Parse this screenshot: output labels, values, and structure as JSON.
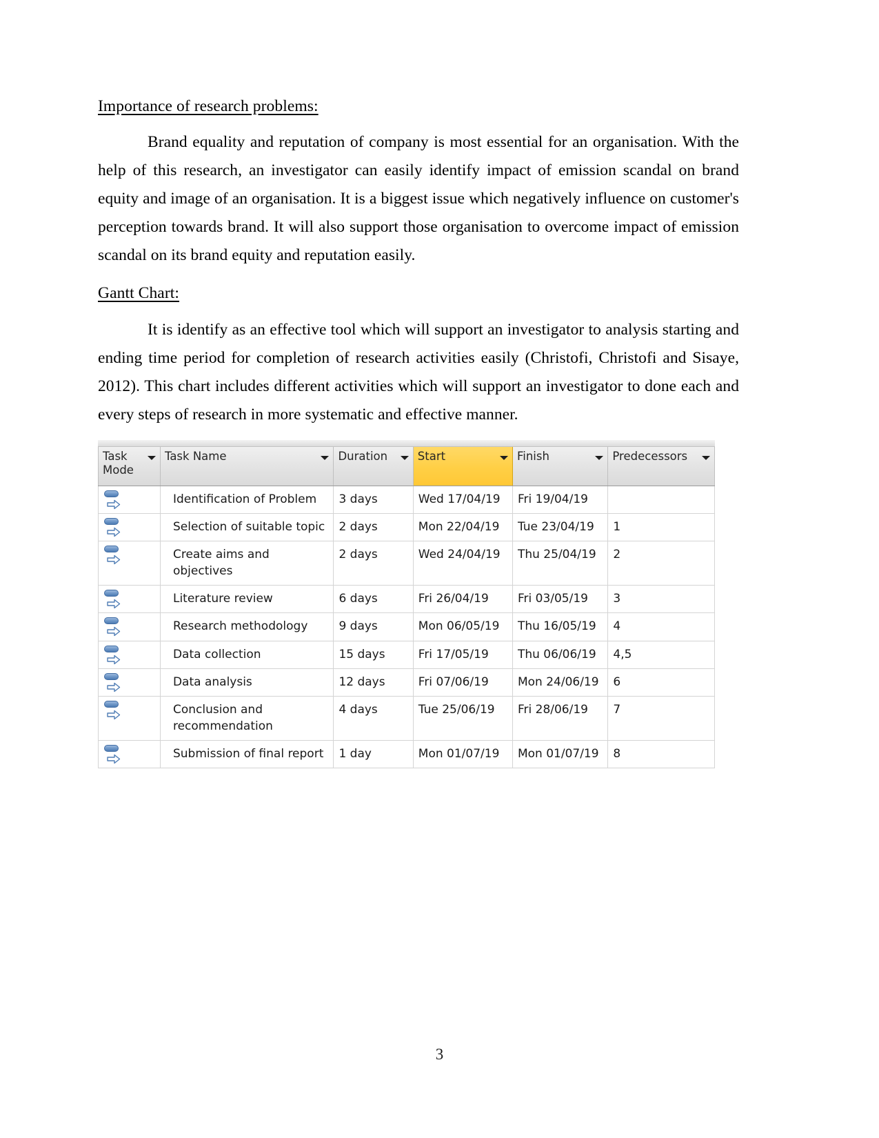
{
  "document": {
    "page_number": "3",
    "sections": [
      {
        "heading": "Importance of research problems: ",
        "paragraph": "Brand equality and reputation of company is most essential for  an organisation. With the help of this research, an investigator can easily identify impact of emission scandal on brand equity and image of an organisation. It is a biggest issue which negatively influence on customer's perception towards brand. It will also support those organisation to overcome impact of emission scandal on its brand equity and reputation easily."
      },
      {
        "heading": "Gantt Chart:",
        "paragraph": "It is identify as an effective tool which will support an investigator to analysis starting and ending time period for completion of research activities easily (Christofi, Christofi and Sisaye, 2012). This chart includes different activities which will support an investigator to done each and every steps of research in more systematic and effective manner."
      }
    ]
  },
  "gantt_table": {
    "highlight_color": "#ffcf45",
    "columns": [
      {
        "label": "Task\nMode",
        "key": "task_mode",
        "highlighted": false,
        "has_filter": true
      },
      {
        "label": "Task Name",
        "key": "task_name",
        "highlighted": false,
        "has_filter": true
      },
      {
        "label": "Duration",
        "key": "duration",
        "highlighted": false,
        "has_filter": true
      },
      {
        "label": "Start",
        "key": "start",
        "highlighted": true,
        "has_filter": true
      },
      {
        "label": "Finish",
        "key": "finish",
        "highlighted": false,
        "has_filter": true
      },
      {
        "label": "Predecessors",
        "key": "predecessors",
        "highlighted": false,
        "has_filter": true
      }
    ],
    "rows": [
      {
        "task_mode_icon": "auto-scheduled-icon",
        "task_name": "Identification of Problem",
        "duration": "3 days",
        "start": "Wed 17/04/19",
        "finish": "Fri 19/04/19",
        "predecessors": ""
      },
      {
        "task_mode_icon": "auto-scheduled-icon",
        "task_name": "Selection of suitable topic",
        "duration": "2 days",
        "start": "Mon 22/04/19",
        "finish": "Tue 23/04/19",
        "predecessors": "1"
      },
      {
        "task_mode_icon": "auto-scheduled-icon",
        "task_name": "Create aims and objectives",
        "duration": "2 days",
        "start": "Wed 24/04/19",
        "finish": "Thu 25/04/19",
        "predecessors": "2"
      },
      {
        "task_mode_icon": "auto-scheduled-icon",
        "task_name": "Literature review",
        "duration": "6 days",
        "start": "Fri 26/04/19",
        "finish": "Fri 03/05/19",
        "predecessors": "3"
      },
      {
        "task_mode_icon": "auto-scheduled-icon",
        "task_name": "Research methodology",
        "duration": "9 days",
        "start": "Mon 06/05/19",
        "finish": "Thu 16/05/19",
        "predecessors": "4"
      },
      {
        "task_mode_icon": "auto-scheduled-icon",
        "task_name": "Data collection",
        "duration": "15 days",
        "start": "Fri 17/05/19",
        "finish": "Thu 06/06/19",
        "predecessors": "4,5"
      },
      {
        "task_mode_icon": "auto-scheduled-icon",
        "task_name": "Data analysis",
        "duration": "12 days",
        "start": "Fri 07/06/19",
        "finish": "Mon 24/06/19",
        "predecessors": "6"
      },
      {
        "task_mode_icon": "auto-scheduled-icon",
        "task_name": "Conclusion and recommendation",
        "duration": "4 days",
        "start": "Tue 25/06/19",
        "finish": "Fri 28/06/19",
        "predecessors": "7"
      },
      {
        "task_mode_icon": "auto-scheduled-icon",
        "task_name": "Submission of final report",
        "duration": "1 day",
        "start": "Mon 01/07/19",
        "finish": "Mon 01/07/19",
        "predecessors": "8"
      }
    ]
  }
}
